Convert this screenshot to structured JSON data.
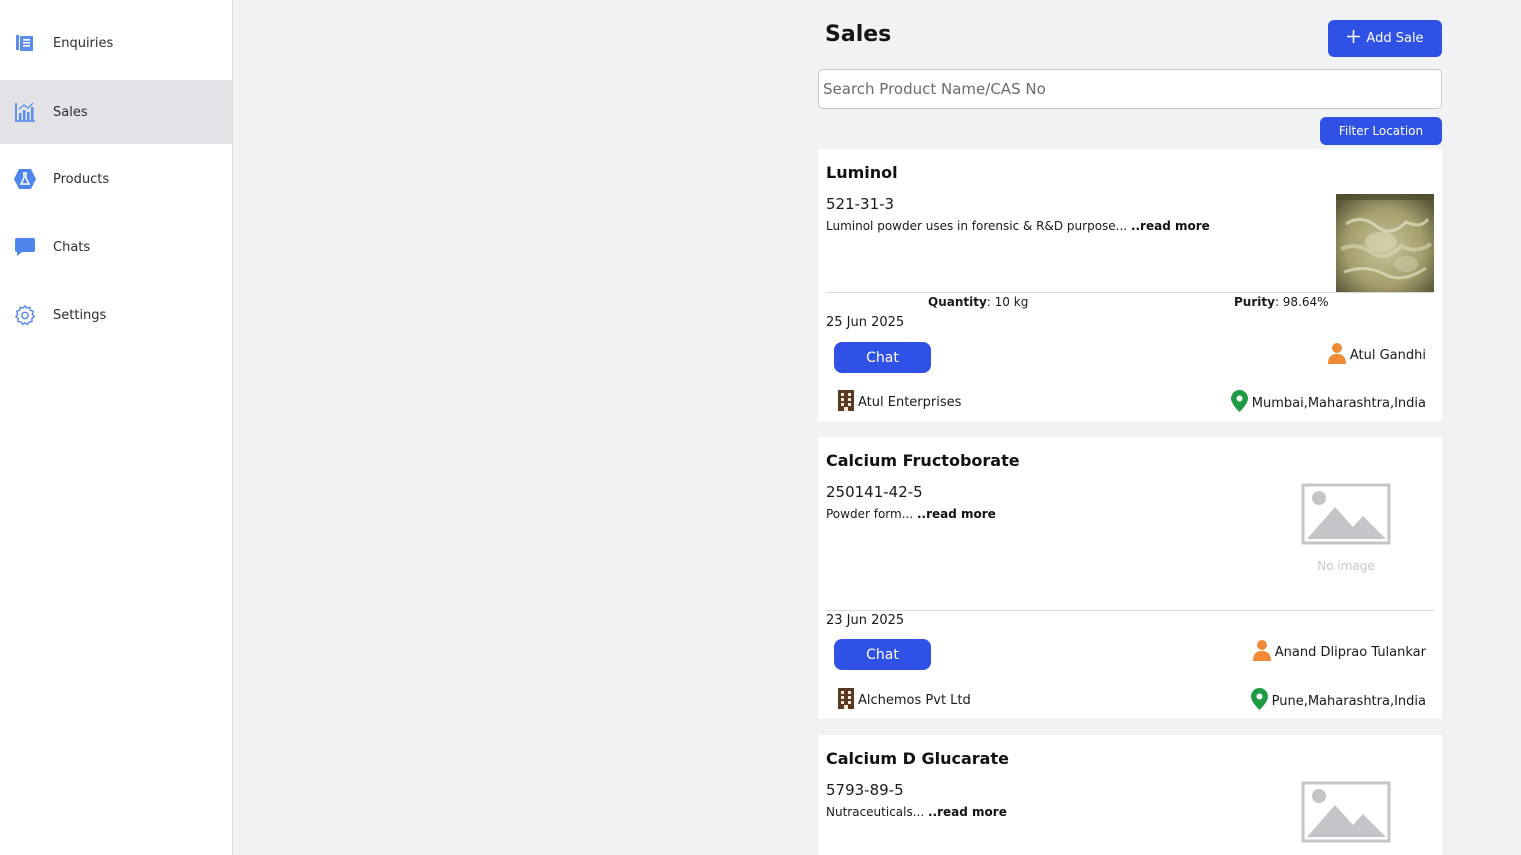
{
  "sidebar": {
    "items": [
      {
        "label": "Enquiries",
        "icon": "enquiries-icon"
      },
      {
        "label": "Sales",
        "icon": "chart-bar-icon"
      },
      {
        "label": "Products",
        "icon": "flask-icon"
      },
      {
        "label": "Chats",
        "icon": "chat-bubble-icon"
      },
      {
        "label": "Settings",
        "icon": "gear-icon"
      }
    ],
    "active": "Sales"
  },
  "header": {
    "title": "Sales",
    "add_sale_label": "Add Sale"
  },
  "search": {
    "placeholder": "Search Product Name/CAS No",
    "value": ""
  },
  "filter": {
    "label": "Filter Location"
  },
  "colors": {
    "primary": "#2f51e6",
    "person_icon": "#f08a35",
    "location_icon": "#1e9a45",
    "building_icon": "#5a3a22",
    "sidebar_icon": "#5b8def"
  },
  "listings": [
    {
      "name": "Luminol",
      "cas": "521-31-3",
      "description": "Luminol powder uses in forensic & R&D purpose... ",
      "read_more": "..read more",
      "quantity_label": "Quantity",
      "quantity_value": ": 10 kg",
      "purity_label": "Purity",
      "purity_value": ": 98.64%",
      "date": "25 Jun 2025",
      "chat_label": "Chat",
      "seller": "Atul Gandhi",
      "company": "Atul Enterprises",
      "location": "Mumbai,Maharashtra,India",
      "has_image": true
    },
    {
      "name": "Calcium Fructoborate",
      "cas": "250141-42-5",
      "description": "Powder form... ",
      "read_more": "..read more",
      "date": "23 Jun 2025",
      "chat_label": "Chat",
      "seller": "Anand Dliprao Tulankar",
      "company": "Alchemos Pvt Ltd",
      "location": "Pune,Maharashtra,India",
      "has_image": false,
      "no_image_text": "No image"
    },
    {
      "name": "Calcium D Glucarate",
      "cas": "5793-89-5",
      "description": "Nutraceuticals... ",
      "read_more": "..read more",
      "has_image": false
    }
  ]
}
